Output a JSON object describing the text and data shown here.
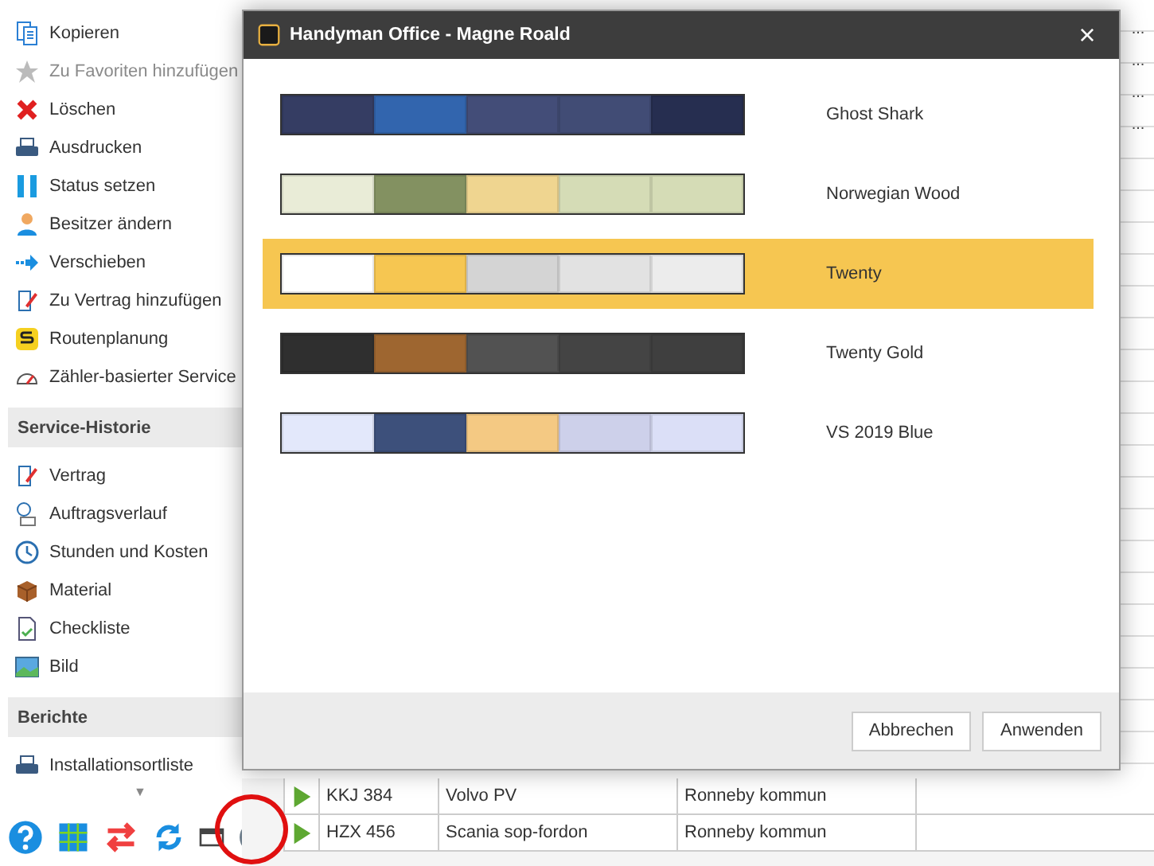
{
  "sidebar": {
    "sections": [
      {
        "items": [
          {
            "label": "Kopieren",
            "disabled": false
          },
          {
            "label": "Zu Favoriten hinzufügen",
            "disabled": true
          },
          {
            "label": "Löschen",
            "disabled": false
          },
          {
            "label": "Ausdrucken",
            "disabled": false
          },
          {
            "label": "Status setzen",
            "disabled": false
          },
          {
            "label": "Besitzer ändern",
            "disabled": false
          },
          {
            "label": "Verschieben",
            "disabled": false
          },
          {
            "label": "Zu Vertrag hinzufügen",
            "disabled": false
          },
          {
            "label": "Routenplanung",
            "disabled": false
          },
          {
            "label": "Zähler-basierter Service",
            "disabled": false
          }
        ]
      },
      {
        "title": "Service-Historie",
        "items": [
          {
            "label": "Vertrag",
            "disabled": false
          },
          {
            "label": "Auftragsverlauf",
            "disabled": false
          },
          {
            "label": "Stunden und Kosten",
            "disabled": false
          },
          {
            "label": "Material",
            "disabled": false
          },
          {
            "label": "Checkliste",
            "disabled": false
          },
          {
            "label": "Bild",
            "disabled": false
          }
        ]
      },
      {
        "title": "Berichte",
        "items": [
          {
            "label": "Installationsortliste",
            "disabled": false
          }
        ]
      }
    ],
    "scroll_caret": "▼"
  },
  "table": {
    "more_buttons": [
      "...",
      "...",
      "...",
      "..."
    ],
    "rows": [
      {
        "cells": [
          "KKJ 384",
          "Volvo PV",
          "Ronneby kommun"
        ]
      },
      {
        "cells": [
          "HZX 456",
          "Scania sop-fordon",
          "Ronneby kommun"
        ]
      }
    ]
  },
  "dialog": {
    "title": "Handyman Office - Magne Roald",
    "close": "×",
    "themes": [
      {
        "name": "Ghost Shark",
        "selected": false,
        "swatches": [
          {
            "color": "#353d63"
          },
          {
            "color": "#3265ae"
          },
          {
            "color": "#434d78"
          },
          {
            "color": "#414c75"
          },
          {
            "color": "#262e50"
          }
        ]
      },
      {
        "name": "Norwegian Wood",
        "selected": false,
        "swatches": [
          {
            "color": "#e9ecd7"
          },
          {
            "color": "#839161"
          },
          {
            "color": "#efd590"
          },
          {
            "color": "#d5dcb6"
          },
          {
            "color": "#d5dcb6"
          }
        ]
      },
      {
        "name": "Twenty",
        "selected": true,
        "swatches": [
          {
            "color": "#ffffff"
          },
          {
            "color": "#f6c651"
          },
          {
            "color": "#d4d4d4"
          },
          {
            "color": "#e2e2e2"
          },
          {
            "color": "#ececec"
          }
        ]
      },
      {
        "name": "Twenty Gold",
        "selected": false,
        "swatches": [
          {
            "color": "#2f2f2f"
          },
          {
            "color": "#9e6630"
          },
          {
            "color": "#525252"
          },
          {
            "color": "#444444"
          },
          {
            "color": "#3f3f3f"
          }
        ]
      },
      {
        "name": "VS 2019 Blue",
        "selected": false,
        "swatches": [
          {
            "color": "#e3e8fb"
          },
          {
            "color": "#3d507b"
          },
          {
            "color": "#f4c983"
          },
          {
            "color": "#cdd0ea"
          },
          {
            "color": "#dbdff7"
          }
        ]
      }
    ],
    "buttons": [
      "Abbrechen",
      "Anwenden"
    ]
  }
}
